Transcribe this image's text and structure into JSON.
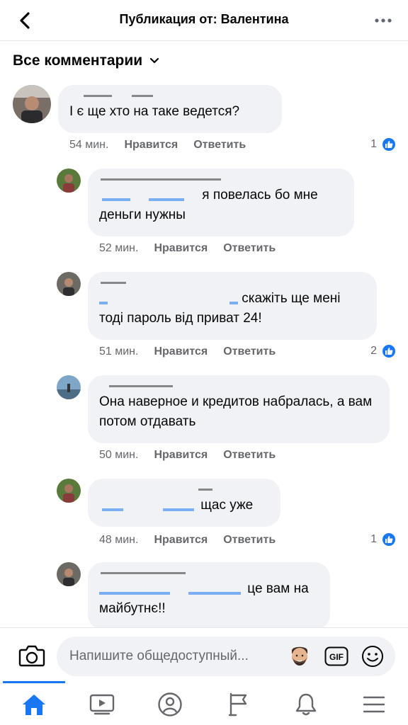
{
  "header": {
    "title": "Публикация от: Валентина"
  },
  "filter": {
    "label": "Все комментарии"
  },
  "comments": [
    {
      "text": "І є ще хто на таке ведется?",
      "time": "54 мин.",
      "like": "Нравится",
      "reply": "Ответить",
      "reactions": "1"
    },
    {
      "text": "я повелась бо мне деньги нужны",
      "time": "52 мин.",
      "like": "Нравится",
      "reply": "Ответить",
      "reactions": ""
    },
    {
      "text": "скажіть ще мені тоді пароль від приват 24!",
      "time": "51 мин.",
      "like": "Нравится",
      "reply": "Ответить",
      "reactions": "2"
    },
    {
      "text": "Она наверное и кредитов набралась, а вам потом отдавать",
      "time": "50 мин.",
      "like": "Нравится",
      "reply": "Ответить",
      "reactions": ""
    },
    {
      "text": "щас уже",
      "time": "48 мин.",
      "like": "Нравится",
      "reply": "Ответить",
      "reactions": "1"
    },
    {
      "text": "це вам на майбутнє!!",
      "time": "",
      "like": "",
      "reply": "",
      "reactions": ""
    }
  ],
  "input": {
    "placeholder": "Напишите общедоступный..."
  },
  "nav": {
    "items": [
      "home-icon",
      "video-icon",
      "profile-icon",
      "pages-flag-icon",
      "notifications-bell-icon",
      "menu-icon"
    ]
  },
  "colors": {
    "accent": "#1877f2",
    "bubble": "#f0f2f5",
    "meta_text": "#65676b"
  }
}
